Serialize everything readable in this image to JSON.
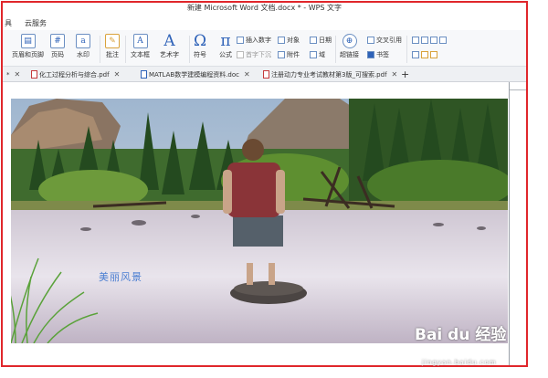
{
  "window": {
    "title": "新建 Microsoft Word 文档.docx * - WPS 文字"
  },
  "menu": {
    "left_item": "具",
    "cloud": "云服务"
  },
  "ribbon": {
    "header_footer": "页眉和页脚",
    "page_number": "页码",
    "watermark": "水印",
    "comment": "批注",
    "textbox": "文本框",
    "wordart": "艺术字",
    "symbol": "符号",
    "formula": "公式",
    "insert_number": "插入数字",
    "object": "对象",
    "date": "日期",
    "first_drop": "首字下沉",
    "attachment": "附件",
    "field": "域",
    "hyperlink": "超链接",
    "cross_ref": "交叉引用",
    "bookmark": "书签",
    "icons": {
      "omega": "Ω",
      "pi": "π",
      "art_a": "A"
    }
  },
  "tabs": [
    {
      "label": "化工过程分析与综合.pdf"
    },
    {
      "label": "MATLAB数学建模编程资料.doc"
    },
    {
      "label": "注册动力专业考试教材第3版_可搜索.pdf"
    }
  ],
  "tabbar": {
    "partial": "*",
    "add": "+"
  },
  "document": {
    "caption": "美丽风景"
  },
  "watermark": {
    "brand": "Bai du 经验",
    "url": "jingyan.baidu.com"
  },
  "colors": {
    "frame_border": "#e0262b",
    "caption": "#4c7fd2",
    "icon_blue": "#2e62b8"
  }
}
